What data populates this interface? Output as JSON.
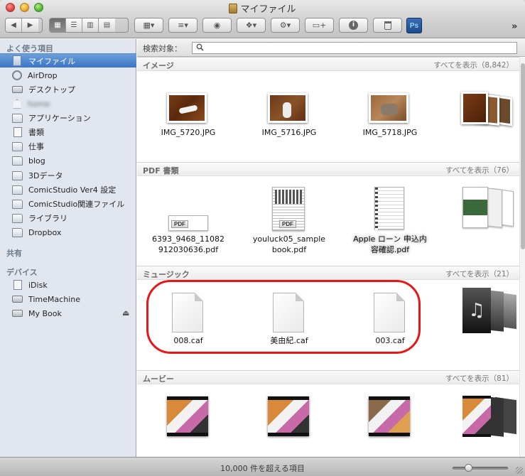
{
  "window": {
    "title": "マイファイル"
  },
  "toolbar": {
    "back_glyph": "◀",
    "forward_glyph": "▶",
    "view_modes": [
      {
        "name": "icon-view",
        "glyph": "▦",
        "active": true
      },
      {
        "name": "list-view",
        "glyph": "☰",
        "active": false
      },
      {
        "name": "column-view",
        "glyph": "▥",
        "active": false
      },
      {
        "name": "coverflow-view",
        "glyph": "▤",
        "active": false
      }
    ],
    "arrange_glyph": "▦▾",
    "sort_glyph": "≡▾",
    "quicklook_glyph": "◉",
    "dropbox_glyph": "❖▾",
    "action_glyph": "⚙▾",
    "newfolder_glyph": "▭+",
    "info_glyph": "i",
    "trash_glyph": "🗑",
    "ps_label": "Ps",
    "more_glyph": "»"
  },
  "sidebar": {
    "favorites_header": "よく使う項目",
    "favorites": [
      {
        "label": "マイファイル",
        "icon": "all-my-files-icon",
        "selected": true
      },
      {
        "label": "AirDrop",
        "icon": "airdrop-icon"
      },
      {
        "label": "デスクトップ",
        "icon": "desktop-icon"
      },
      {
        "label": "home",
        "icon": "home-icon",
        "blurred": true
      },
      {
        "label": "アプリケーション",
        "icon": "applications-icon"
      },
      {
        "label": "書類",
        "icon": "documents-icon"
      },
      {
        "label": "仕事",
        "icon": "folder-icon"
      },
      {
        "label": "blog",
        "icon": "folder-icon"
      },
      {
        "label": "3Dデータ",
        "icon": "folder-icon"
      },
      {
        "label": "ComicStudio Ver4 設定",
        "icon": "folder-icon"
      },
      {
        "label": "ComicStudio関連ファイル",
        "icon": "folder-icon"
      },
      {
        "label": "ライブラリ",
        "icon": "folder-icon"
      },
      {
        "label": "Dropbox",
        "icon": "folder-icon"
      }
    ],
    "shared_header": "共有",
    "devices_header": "デバイス",
    "devices": [
      {
        "label": "iDisk",
        "icon": "idisk-icon"
      },
      {
        "label": "TimeMachine",
        "icon": "disk-icon"
      },
      {
        "label": "My Book",
        "icon": "disk-icon",
        "eject": true
      }
    ],
    "eject_glyph": "⏏"
  },
  "search": {
    "label": "検索対象：",
    "value": ""
  },
  "sections": {
    "images": {
      "title": "イメージ",
      "show_all": "すべてを表示（8,842）",
      "items": [
        "IMG_5720.JPG",
        "IMG_5716.JPG",
        "IMG_5718.JPG"
      ]
    },
    "pdf": {
      "title": "PDF 書類",
      "show_all": "すべてを表示（76）",
      "items": [
        "6393_9468_11082\n912030636.pdf",
        "youluck05_sample\nbook.pdf",
        "Apple ローン 申込内\n容確認.pdf"
      ],
      "pdf_tag": "PDF"
    },
    "music": {
      "title": "ミュージック",
      "show_all": "すべてを表示（21）",
      "items": [
        "008.caf",
        "美由紀.caf",
        "003.caf"
      ]
    },
    "movies": {
      "title": "ムービー",
      "show_all": "すべてを表示（81）"
    }
  },
  "status": {
    "text": "10,000 件を超える項目",
    "icon_size_level": 0.25
  },
  "colors": {
    "selection": "#3a75c4",
    "highlight_ring": "#e31818",
    "sidebar_bg": "#e2e7ef"
  }
}
